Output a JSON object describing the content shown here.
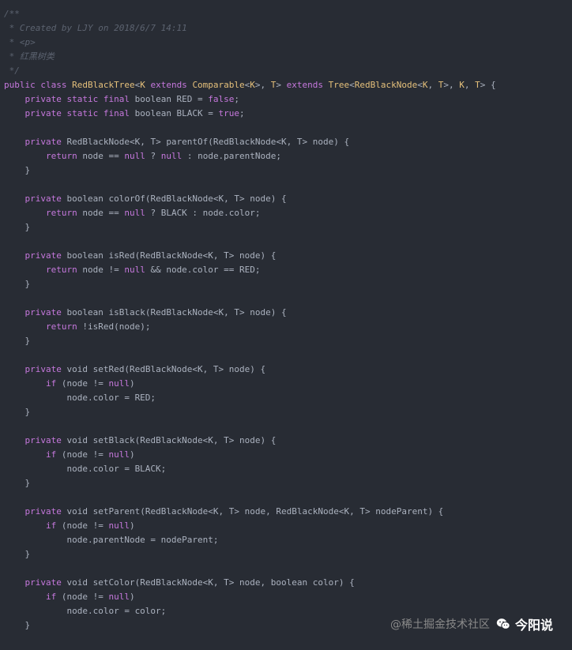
{
  "colors": {
    "background": "#282c34",
    "comment": "#5c6370",
    "keyword": "#c678dd",
    "type": "#e5c07b",
    "plain": "#abb2bf"
  },
  "code_lines": [
    [
      {
        "t": "/**",
        "c": "comment"
      }
    ],
    [
      {
        "t": " * Created by LJY on 2018/6/7 14:11",
        "c": "comment"
      }
    ],
    [
      {
        "t": " * <p>",
        "c": "comment"
      }
    ],
    [
      {
        "t": " * 红黑树类",
        "c": "comment"
      }
    ],
    [
      {
        "t": " */",
        "c": "comment"
      }
    ],
    [
      {
        "t": "public class ",
        "c": "keyword"
      },
      {
        "t": "RedBlackTree",
        "c": "type"
      },
      {
        "t": "<",
        "c": "plain"
      },
      {
        "t": "K",
        "c": "type"
      },
      {
        "t": " extends ",
        "c": "keyword"
      },
      {
        "t": "Comparable",
        "c": "type"
      },
      {
        "t": "<",
        "c": "plain"
      },
      {
        "t": "K",
        "c": "type"
      },
      {
        "t": ">, ",
        "c": "plain"
      },
      {
        "t": "T",
        "c": "type"
      },
      {
        "t": "> ",
        "c": "plain"
      },
      {
        "t": "extends ",
        "c": "keyword"
      },
      {
        "t": "Tree",
        "c": "type"
      },
      {
        "t": "<",
        "c": "plain"
      },
      {
        "t": "RedBlackNode",
        "c": "type"
      },
      {
        "t": "<",
        "c": "plain"
      },
      {
        "t": "K",
        "c": "type"
      },
      {
        "t": ", ",
        "c": "plain"
      },
      {
        "t": "T",
        "c": "type"
      },
      {
        "t": ">, ",
        "c": "plain"
      },
      {
        "t": "K",
        "c": "type"
      },
      {
        "t": ", ",
        "c": "plain"
      },
      {
        "t": "T",
        "c": "type"
      },
      {
        "t": "> {",
        "c": "plain"
      }
    ],
    [
      {
        "t": "    ",
        "c": "plain"
      },
      {
        "t": "private static final ",
        "c": "keyword"
      },
      {
        "t": "boolean RED = ",
        "c": "plain"
      },
      {
        "t": "false",
        "c": "keyword"
      },
      {
        "t": ";",
        "c": "plain"
      }
    ],
    [
      {
        "t": "    ",
        "c": "plain"
      },
      {
        "t": "private static final ",
        "c": "keyword"
      },
      {
        "t": "boolean BLACK = ",
        "c": "plain"
      },
      {
        "t": "true",
        "c": "keyword"
      },
      {
        "t": ";",
        "c": "plain"
      }
    ],
    [],
    [
      {
        "t": "    ",
        "c": "plain"
      },
      {
        "t": "private ",
        "c": "keyword"
      },
      {
        "t": "RedBlackNode<K, T> parentOf(RedBlackNode<K, T> node) {",
        "c": "plain"
      }
    ],
    [
      {
        "t": "        ",
        "c": "plain"
      },
      {
        "t": "return ",
        "c": "keyword"
      },
      {
        "t": "node == ",
        "c": "plain"
      },
      {
        "t": "null",
        "c": "keyword"
      },
      {
        "t": " ? ",
        "c": "plain"
      },
      {
        "t": "null",
        "c": "keyword"
      },
      {
        "t": " : node.parentNode;",
        "c": "plain"
      }
    ],
    [
      {
        "t": "    }",
        "c": "plain"
      }
    ],
    [],
    [
      {
        "t": "    ",
        "c": "plain"
      },
      {
        "t": "private ",
        "c": "keyword"
      },
      {
        "t": "boolean colorOf(RedBlackNode<K, T> node) {",
        "c": "plain"
      }
    ],
    [
      {
        "t": "        ",
        "c": "plain"
      },
      {
        "t": "return ",
        "c": "keyword"
      },
      {
        "t": "node == ",
        "c": "plain"
      },
      {
        "t": "null",
        "c": "keyword"
      },
      {
        "t": " ? BLACK : node.color;",
        "c": "plain"
      }
    ],
    [
      {
        "t": "    }",
        "c": "plain"
      }
    ],
    [],
    [
      {
        "t": "    ",
        "c": "plain"
      },
      {
        "t": "private ",
        "c": "keyword"
      },
      {
        "t": "boolean isRed(RedBlackNode<K, T> node) {",
        "c": "plain"
      }
    ],
    [
      {
        "t": "        ",
        "c": "plain"
      },
      {
        "t": "return ",
        "c": "keyword"
      },
      {
        "t": "node != ",
        "c": "plain"
      },
      {
        "t": "null",
        "c": "keyword"
      },
      {
        "t": " && node.color == RED;",
        "c": "plain"
      }
    ],
    [
      {
        "t": "    }",
        "c": "plain"
      }
    ],
    [],
    [
      {
        "t": "    ",
        "c": "plain"
      },
      {
        "t": "private ",
        "c": "keyword"
      },
      {
        "t": "boolean isBlack(RedBlackNode<K, T> node) {",
        "c": "plain"
      }
    ],
    [
      {
        "t": "        ",
        "c": "plain"
      },
      {
        "t": "return ",
        "c": "keyword"
      },
      {
        "t": "!isRed(node);",
        "c": "plain"
      }
    ],
    [
      {
        "t": "    }",
        "c": "plain"
      }
    ],
    [],
    [
      {
        "t": "    ",
        "c": "plain"
      },
      {
        "t": "private ",
        "c": "keyword"
      },
      {
        "t": "void setRed(RedBlackNode<K, T> node) {",
        "c": "plain"
      }
    ],
    [
      {
        "t": "        ",
        "c": "plain"
      },
      {
        "t": "if ",
        "c": "keyword"
      },
      {
        "t": "(node != ",
        "c": "plain"
      },
      {
        "t": "null",
        "c": "keyword"
      },
      {
        "t": ")",
        "c": "plain"
      }
    ],
    [
      {
        "t": "            node.color = RED;",
        "c": "plain"
      }
    ],
    [
      {
        "t": "    }",
        "c": "plain"
      }
    ],
    [],
    [
      {
        "t": "    ",
        "c": "plain"
      },
      {
        "t": "private ",
        "c": "keyword"
      },
      {
        "t": "void setBlack(RedBlackNode<K, T> node) {",
        "c": "plain"
      }
    ],
    [
      {
        "t": "        ",
        "c": "plain"
      },
      {
        "t": "if ",
        "c": "keyword"
      },
      {
        "t": "(node != ",
        "c": "plain"
      },
      {
        "t": "null",
        "c": "keyword"
      },
      {
        "t": ")",
        "c": "plain"
      }
    ],
    [
      {
        "t": "            node.color = BLACK;",
        "c": "plain"
      }
    ],
    [
      {
        "t": "    }",
        "c": "plain"
      }
    ],
    [],
    [
      {
        "t": "    ",
        "c": "plain"
      },
      {
        "t": "private ",
        "c": "keyword"
      },
      {
        "t": "void setParent(RedBlackNode<K, T> node, RedBlackNode<K, T> nodeParent) {",
        "c": "plain"
      }
    ],
    [
      {
        "t": "        ",
        "c": "plain"
      },
      {
        "t": "if ",
        "c": "keyword"
      },
      {
        "t": "(node != ",
        "c": "plain"
      },
      {
        "t": "null",
        "c": "keyword"
      },
      {
        "t": ")",
        "c": "plain"
      }
    ],
    [
      {
        "t": "            node.parentNode = nodeParent;",
        "c": "plain"
      }
    ],
    [
      {
        "t": "    }",
        "c": "plain"
      }
    ],
    [],
    [
      {
        "t": "    ",
        "c": "plain"
      },
      {
        "t": "private ",
        "c": "keyword"
      },
      {
        "t": "void setColor(RedBlackNode<K, T> node, boolean color) {",
        "c": "plain"
      }
    ],
    [
      {
        "t": "        ",
        "c": "plain"
      },
      {
        "t": "if ",
        "c": "keyword"
      },
      {
        "t": "(node != ",
        "c": "plain"
      },
      {
        "t": "null",
        "c": "keyword"
      },
      {
        "t": ")",
        "c": "plain"
      }
    ],
    [
      {
        "t": "            node.color = color;",
        "c": "plain"
      }
    ],
    [
      {
        "t": "    }",
        "c": "plain"
      }
    ]
  ],
  "watermark": {
    "left_text": "@稀土掘金技术社区",
    "icon": "wechat-icon",
    "right_text": "今阳说"
  }
}
